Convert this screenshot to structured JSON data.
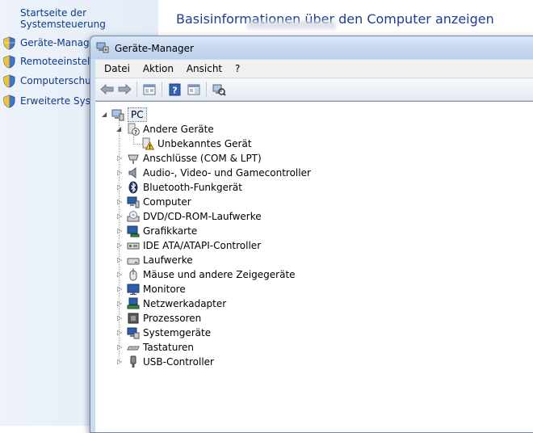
{
  "control_panel": {
    "home_link": "Startseite der Systemsteuerung",
    "links": [
      {
        "label": "Geräte-Manager",
        "icon": "shield-icon"
      },
      {
        "label": "Remoteeinstellu",
        "icon": "shield-icon"
      },
      {
        "label": "Computerschutz",
        "icon": "shield-icon"
      },
      {
        "label": "Erweiterte Syster",
        "icon": "shield-icon"
      }
    ],
    "main_title": "Basisinformationen über den Computer anzeigen"
  },
  "window": {
    "title": "Geräte-Manager",
    "menu": [
      "Datei",
      "Aktion",
      "Ansicht",
      "?"
    ],
    "toolbar_icons": [
      "back-arrow-icon",
      "forward-arrow-icon",
      "properties-view-icon",
      "help-icon",
      "console-tree-icon",
      "scan-hardware-icon"
    ]
  },
  "tree": {
    "root": "PC",
    "items": [
      {
        "label": "Andere Geräte",
        "icon": "unknown-device-icon",
        "expanded": true
      },
      {
        "label": "Unbekanntes Gerät",
        "icon": "warning-device-icon",
        "child": true
      },
      {
        "label": "Anschlüsse (COM & LPT)",
        "icon": "port-icon"
      },
      {
        "label": "Audio-, Video- und Gamecontroller",
        "icon": "speaker-icon"
      },
      {
        "label": "Bluetooth-Funkgerät",
        "icon": "bluetooth-icon"
      },
      {
        "label": "Computer",
        "icon": "computer-icon"
      },
      {
        "label": "DVD/CD-ROM-Laufwerke",
        "icon": "dvd-drive-icon"
      },
      {
        "label": "Grafikkarte",
        "icon": "display-adapter-icon"
      },
      {
        "label": "IDE ATA/ATAPI-Controller",
        "icon": "ide-controller-icon"
      },
      {
        "label": "Laufwerke",
        "icon": "disk-drive-icon"
      },
      {
        "label": "Mäuse und andere Zeigegeräte",
        "icon": "mouse-icon"
      },
      {
        "label": "Monitore",
        "icon": "monitor-icon"
      },
      {
        "label": "Netzwerkadapter",
        "icon": "network-adapter-icon"
      },
      {
        "label": "Prozessoren",
        "icon": "processor-icon"
      },
      {
        "label": "Systemgeräte",
        "icon": "system-device-icon"
      },
      {
        "label": "Tastaturen",
        "icon": "keyboard-icon"
      },
      {
        "label": "USB-Controller",
        "icon": "usb-icon"
      }
    ]
  }
}
